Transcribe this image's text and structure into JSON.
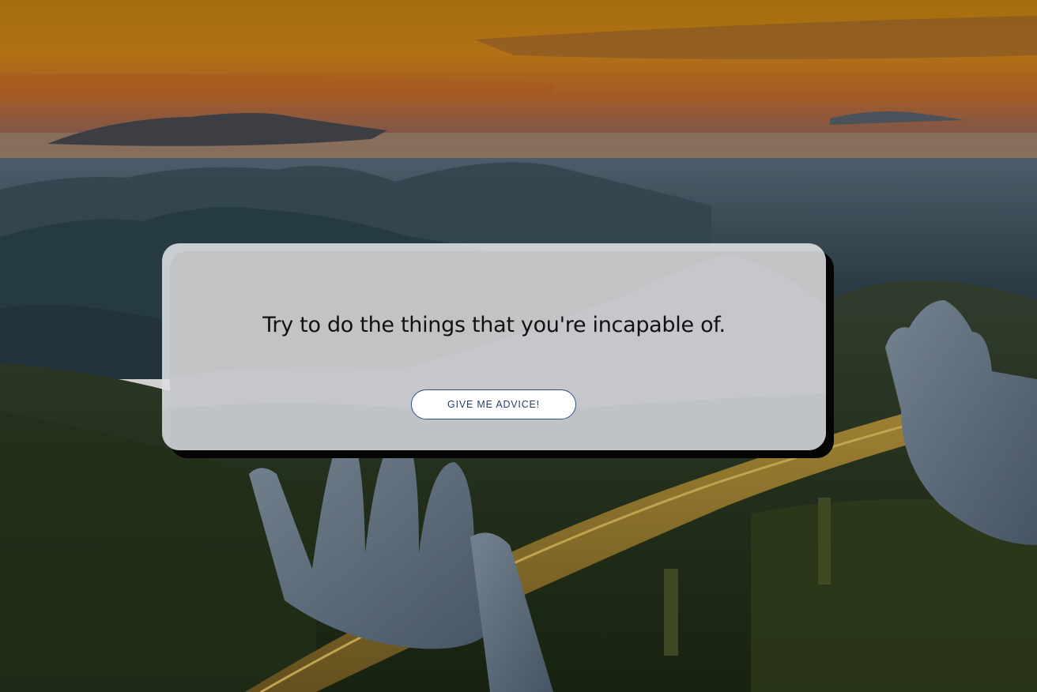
{
  "advice": {
    "quote": "Try to do the things that you're incapable of.",
    "button_label": "GIVE ME ADVICE!"
  },
  "theme": {
    "button_border": "#2d4f8a",
    "button_text": "#2a3f66",
    "card_shadow": "#050505"
  }
}
